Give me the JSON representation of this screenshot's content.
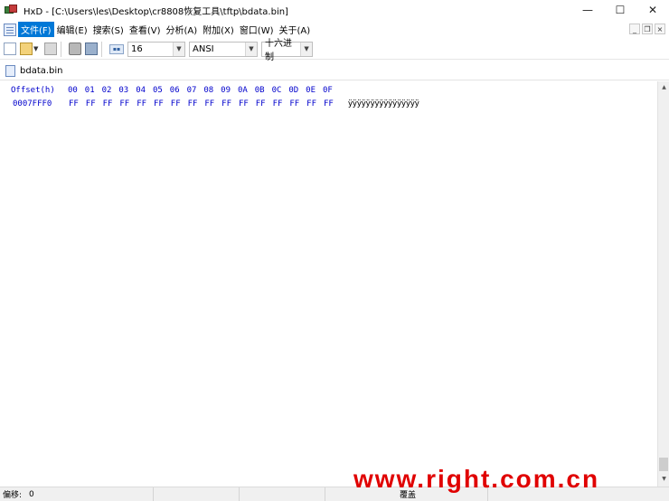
{
  "window": {
    "title": "HxD - [C:\\Users\\les\\Desktop\\cr8808恢复工具\\tftp\\bdata.bin]",
    "controls": {
      "minimize": "—",
      "maximize": "☐",
      "close": "✕"
    }
  },
  "menu": {
    "items": [
      "文件(F)",
      "编辑(E)",
      "搜索(S)",
      "查看(V)",
      "分析(A)",
      "附加(X)",
      "窗口(W)",
      "关于(A)"
    ],
    "active_index": 0,
    "mdi_controls": {
      "minimize": "_",
      "restore": "❐",
      "close": "×"
    }
  },
  "toolbar": {
    "bytes_per_row": "16",
    "charset": "ANSI",
    "offset_base": "十六进制"
  },
  "tab": {
    "label": "bdata.bin"
  },
  "hex": {
    "header_label": "Offset(h)",
    "columns": [
      "00",
      "01",
      "02",
      "03",
      "04",
      "05",
      "06",
      "07",
      "08",
      "09",
      "0A",
      "0B",
      "0C",
      "0D",
      "0E",
      "0F"
    ],
    "rows": [
      {
        "offset": "0007FFF0",
        "bytes": [
          "FF",
          "FF",
          "FF",
          "FF",
          "FF",
          "FF",
          "FF",
          "FF",
          "FF",
          "FF",
          "FF",
          "FF",
          "FF",
          "FF",
          "FF",
          "FF"
        ],
        "ascii": "ÿÿÿÿÿÿÿÿÿÿÿÿÿÿÿÿ"
      }
    ]
  },
  "status": {
    "offset_label": "偏移:",
    "offset_value": "0",
    "mode": "覆盖"
  },
  "watermark": "www.right.com.cn",
  "colors": {
    "hex_text": "#0000cc",
    "menu_active": "#0078d7",
    "watermark": "#e00000"
  }
}
